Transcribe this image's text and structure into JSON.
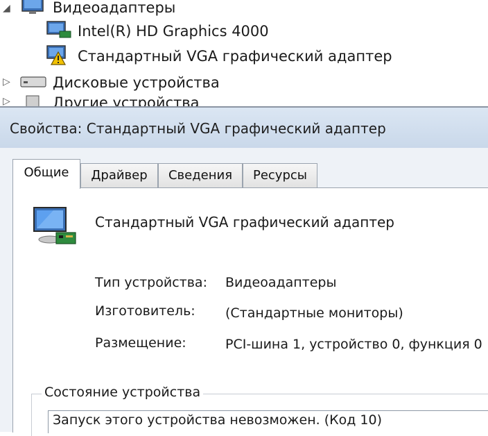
{
  "tree": {
    "category_label": "Видеоадаптеры",
    "items": [
      {
        "label": "Intel(R) HD Graphics 4000"
      },
      {
        "label": "Стандартный VGA графический адаптер"
      }
    ],
    "disk_label": "Дисковые устройства",
    "partial_label": "Другие устройства"
  },
  "dialog": {
    "title": "Свойства: Стандартный VGA графический адаптер",
    "tabs": [
      {
        "label": "Общие"
      },
      {
        "label": "Драйвер"
      },
      {
        "label": "Сведения"
      },
      {
        "label": "Ресурсы"
      }
    ],
    "active_tab": "Общие",
    "device_name": "Стандартный VGA графический адаптер",
    "properties": [
      {
        "label": "Тип устройства:",
        "value": "Видеоадаптеры"
      },
      {
        "label": "Изготовитель:",
        "value": "(Стандартные мониторы)"
      },
      {
        "label": "Размещение:",
        "value": "PCI-шина 1, устройство 0, функция 0"
      }
    ],
    "status_group_title": "Состояние устройства",
    "status_text": "Запуск этого устройства невозможен. (Код 10)"
  },
  "colors": {
    "titlebar": "#c9d8ea",
    "warning": "#f2c200",
    "monitor_screen": "#1f6fd1"
  },
  "icons": [
    "monitor-icon",
    "warning-icon",
    "disk-drive-icon",
    "display-adapter-icon"
  ]
}
